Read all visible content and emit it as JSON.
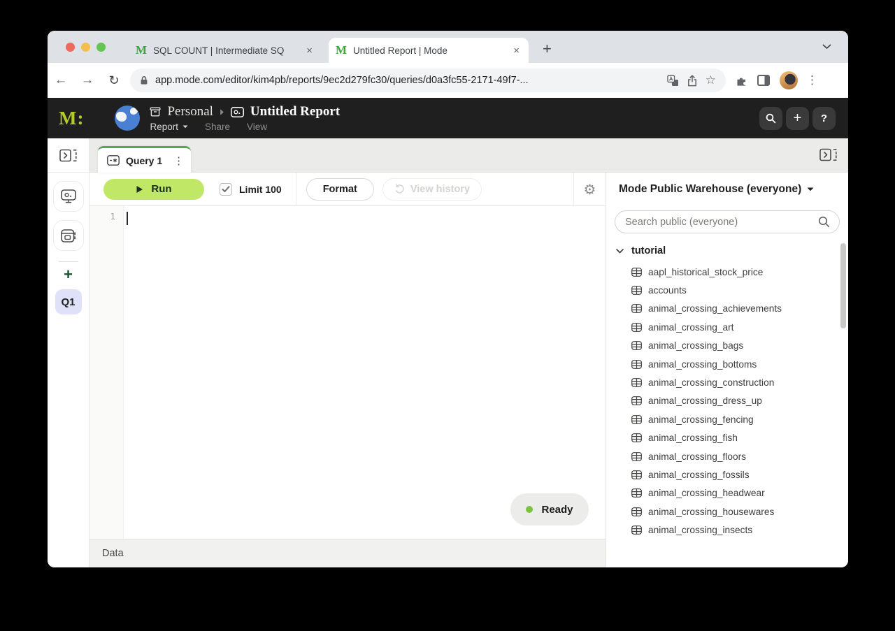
{
  "browser": {
    "tab1_title": "SQL COUNT | Intermediate SQ",
    "tab2_title": "Untitled Report | Mode",
    "favicon_letter": "M",
    "url": "app.mode.com/editor/kim4pb/reports/9ec2d279fc30/queries/d0a3fc55-2171-49f7-..."
  },
  "icons": {
    "back": "←",
    "forward": "→",
    "reload": "↻",
    "star": "☆",
    "kebab": "⋮",
    "close": "×",
    "new_tab": "+",
    "gear": "⚙",
    "plus": "+",
    "help": "?"
  },
  "app_header": {
    "logo": "M:",
    "workspace": "Personal",
    "report_title": "Untitled Report",
    "menu_report": "Report",
    "menu_share": "Share",
    "menu_view": "View"
  },
  "sidebar": {
    "query_badge": "Q1",
    "add_label": "+"
  },
  "query_editor": {
    "tab_label": "Query 1",
    "run_label": "Run",
    "limit_label": "Limit 100",
    "format_label": "Format",
    "view_history_label": "View history",
    "line_number": "1",
    "status_ready": "Ready",
    "data_tab": "Data"
  },
  "right_panel": {
    "title": "Mode Public Warehouse (everyone)",
    "search_placeholder": "Search public (everyone)",
    "schema": "tutorial",
    "tables": [
      "aapl_historical_stock_price",
      "accounts",
      "animal_crossing_achievements",
      "animal_crossing_art",
      "animal_crossing_bags",
      "animal_crossing_bottoms",
      "animal_crossing_construction",
      "animal_crossing_dress_up",
      "animal_crossing_fencing",
      "animal_crossing_fish",
      "animal_crossing_floors",
      "animal_crossing_fossils",
      "animal_crossing_headwear",
      "animal_crossing_housewares",
      "animal_crossing_insects"
    ]
  },
  "colors": {
    "mode_logo_green": "#b5cb25",
    "favicon_green": "#41a33e",
    "run_button_green": "#c0e866",
    "query_tab_accent": "#52a852",
    "ready_dot": "#7dc242",
    "q1_badge_bg": "#dee1f8",
    "app_header_bg": "#1f1f1f"
  }
}
